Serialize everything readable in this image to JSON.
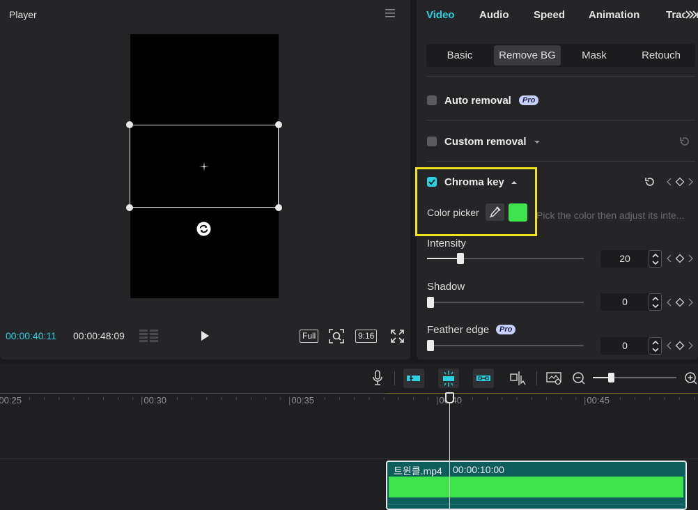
{
  "player": {
    "title": "Player",
    "time_current": "00:00:40:11",
    "time_total": "00:00:48:09",
    "full_label": "Full",
    "ratio_label": "9:16"
  },
  "props": {
    "tabs": {
      "video": "Video",
      "audio": "Audio",
      "speed": "Speed",
      "animation": "Animation",
      "tracking": "Tracking"
    },
    "subtabs": {
      "basic": "Basic",
      "remove_bg": "Remove BG",
      "mask": "Mask",
      "retouch": "Retouch"
    },
    "auto_removal": {
      "label": "Auto removal",
      "badge": "Pro",
      "checked": false
    },
    "custom_removal": {
      "label": "Custom removal",
      "checked": false
    },
    "chroma_key": {
      "label": "Chroma key",
      "checked": true,
      "color_picker_label": "Color picker",
      "picked_color": "#3ee24b",
      "hint": "Pick the color then adjust its inte..."
    },
    "intensity": {
      "label": "Intensity",
      "value": "20",
      "fraction": 0.2
    },
    "shadow": {
      "label": "Shadow",
      "value": "0",
      "fraction": 0
    },
    "feather_edge": {
      "label": "Feather edge",
      "badge": "Pro",
      "value": "0",
      "fraction": 0
    }
  },
  "timeline": {
    "ticks": [
      "00:25",
      "00:30",
      "00:35",
      "00:40",
      "00:45"
    ],
    "clip": {
      "name": "트윈클.mp4",
      "duration": "00:00:10:00",
      "color": "#3ee24b"
    }
  },
  "colors": {
    "accent": "#2ad1e1",
    "highlight_box": "#f0e21c"
  }
}
